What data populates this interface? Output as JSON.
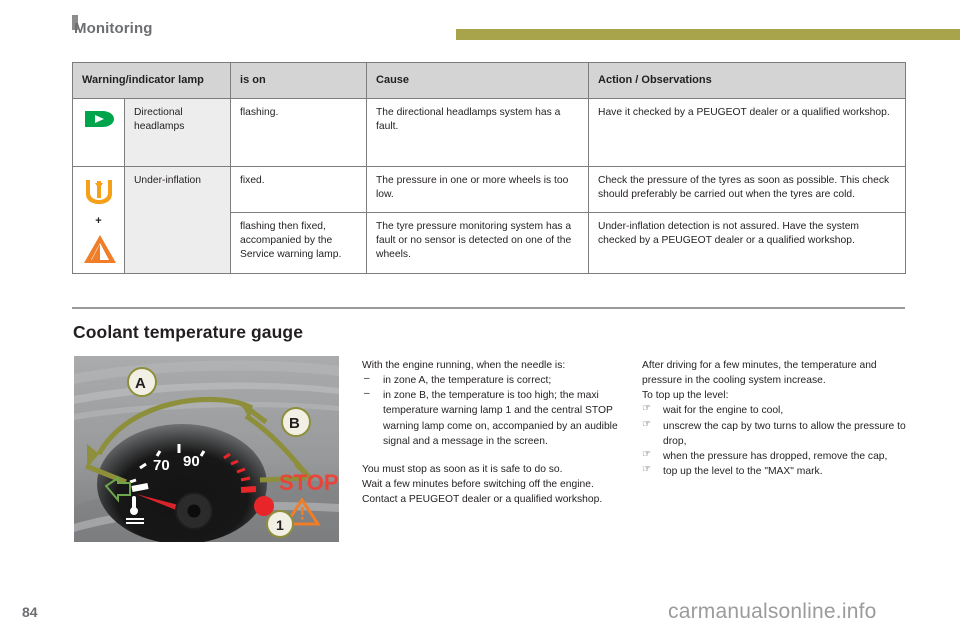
{
  "header": {
    "title": "Monitoring",
    "accent_color": "#a8a44c"
  },
  "table": {
    "columns": [
      "Warning/indicator lamp",
      "is on",
      "Cause",
      "Action / Observations"
    ],
    "rows": [
      {
        "icon": "directional-headlamp-icon",
        "icon_color": "#00a44b",
        "lamp_name": "Directional headlamps",
        "is_on": "flashing.",
        "cause": "The directional headlamps system has a fault.",
        "action": "Have it checked by a PEUGEOT dealer or a qualified workshop."
      },
      {
        "icon": "tyre-under-inflation-icon",
        "icon_color": "#f6a01a",
        "lamp_name": "Under-inflation",
        "is_on": "fixed.",
        "cause": "The pressure in one or more wheels is too low.",
        "action": "Check the pressure of the tyres as soon as possible. This check should preferably be carried out when the tyres are cold."
      },
      {
        "icon": "service-warning-triangle-icon",
        "icon_color": "#f07d27",
        "plus_symbol": "+",
        "lamp_name": "",
        "is_on": "flashing then fixed, accompanied by the Service warning lamp.",
        "cause": "The tyre pressure monitoring system has a fault or no sensor is detected on one of the wheels.",
        "action": "Under-inflation detection is not assured. Have the system checked by a PEUGEOT dealer or a qualified workshop."
      }
    ]
  },
  "section": {
    "title": "Coolant temperature gauge"
  },
  "figure": {
    "alt": "coolant-temperature-gauge-illustration",
    "zone_a_label": "A",
    "zone_b_label": "B",
    "callout_1_label": "1",
    "dial_low_value": "70",
    "dial_high_value": "90",
    "stop_text": "STOP"
  },
  "middle_column": {
    "intro": "With the engine running, when the needle is:",
    "bullets": [
      "in zone A, the temperature is correct;",
      "in zone B, the temperature is too high; the maxi temperature warning lamp 1 and the central STOP warning lamp come on, accompanied by an audible signal and a message in the screen."
    ],
    "bullet_glyph": "–",
    "warning_lines": [
      "You must stop as soon as it is safe to do so.",
      "Wait a few minutes before switching off the engine.",
      "Contact a PEUGEOT dealer or a qualified workshop."
    ]
  },
  "right_column": {
    "intro_lines": [
      "After driving for a few minutes, the temperature and pressure in the cooling system increase.",
      "To top up the level:"
    ],
    "bullet_glyph": "☞",
    "steps": [
      "wait for the engine to cool,",
      "unscrew the cap by two turns to allow the pressure to drop,",
      "when the pressure has dropped, remove the cap,",
      "top up the level to the \"MAX\" mark."
    ]
  },
  "footer": {
    "page_number": "84",
    "watermark": "carmanualsonline.info"
  }
}
